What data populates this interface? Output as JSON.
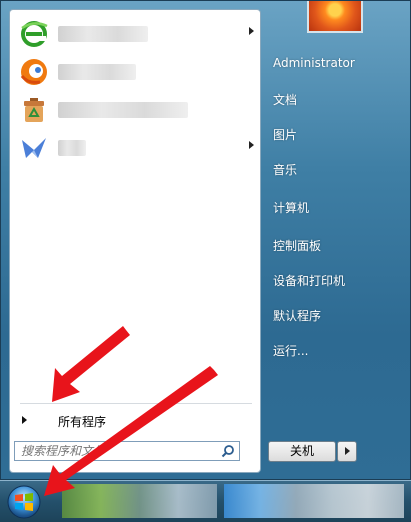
{
  "user": {
    "name": "Administrator"
  },
  "right_links": [
    {
      "id": "docs",
      "label": "文档"
    },
    {
      "id": "pictures",
      "label": "图片"
    },
    {
      "id": "music",
      "label": "音乐"
    },
    {
      "id": "computer",
      "label": "计算机"
    },
    {
      "id": "control-panel",
      "label": "控制面板"
    },
    {
      "id": "devices-printers",
      "label": "设备和打印机"
    },
    {
      "id": "default-programs",
      "label": "默认程序"
    },
    {
      "id": "run",
      "label": "运行..."
    }
  ],
  "left": {
    "all_programs": "所有程序",
    "search_placeholder": "搜索程序和文件"
  },
  "shutdown": {
    "label": "关机"
  },
  "colors": {
    "annotation_arrow": "#e8141b",
    "menu_blue": "#3f7fa5"
  }
}
